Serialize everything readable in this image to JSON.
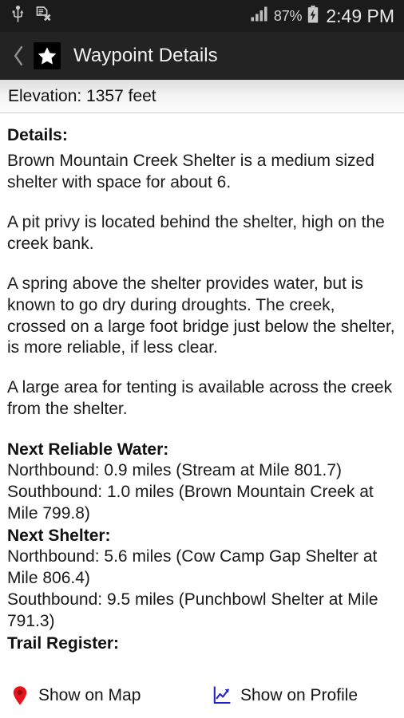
{
  "status_bar": {
    "icons_left": [
      "usb-icon",
      "no-sd-card-icon"
    ],
    "signal_icon": "signal-bars-icon",
    "battery_percent": "87%",
    "battery_icon": "battery-charging-icon",
    "clock": "2:49 PM"
  },
  "action_bar": {
    "back_icon": "back-chevron-icon",
    "app_icon": "star-icon",
    "title": "Waypoint Details"
  },
  "elevation": {
    "text": "Elevation: 1357 feet"
  },
  "details": {
    "heading": "Details:",
    "paragraphs": [
      "Brown Mountain Creek Shelter is a medium sized shelter with space for about 6.",
      "A pit privy is located behind the shelter, high on the creek bank.",
      "A spring above the shelter provides water, but is known to go dry during droughts. The creek, crossed on a large foot bridge just below the shelter, is more reliable, if less clear.",
      "A large area for tenting is available across the creek from the shelter."
    ]
  },
  "next_reliable_water": {
    "heading": "Next Reliable Water:",
    "northbound": "Northbound: 0.9 miles (Stream at Mile 801.7)",
    "southbound": "Southbound: 1.0 miles (Brown Mountain Creek at Mile 799.8)"
  },
  "next_shelter": {
    "heading": "Next Shelter:",
    "northbound": "Northbound: 5.6 miles (Cow Camp Gap Shelter at Mile 806.4)",
    "southbound": "Southbound: 9.5 miles (Punchbowl Shelter at Mile 791.3)"
  },
  "trail_register": {
    "heading": "Trail Register:"
  },
  "bottom_bar": {
    "show_on_map": {
      "label": "Show on Map",
      "icon": "map-pin-icon",
      "color": "#e8131a"
    },
    "show_on_profile": {
      "label": "Show on Profile",
      "icon": "line-chart-icon",
      "color": "#2222cc"
    }
  }
}
